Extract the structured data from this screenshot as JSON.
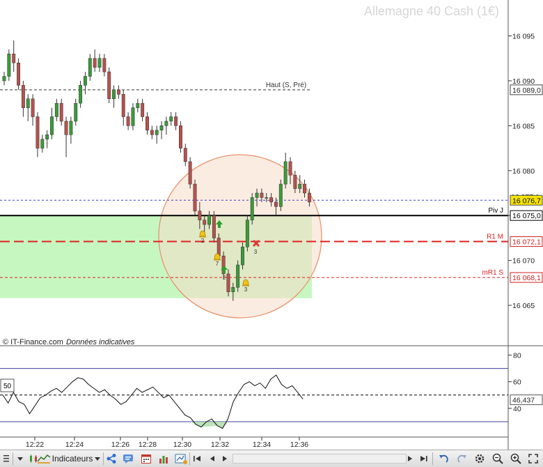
{
  "header": {
    "title": "Allemagne 40 Cash (1€)"
  },
  "footer": {
    "source": "© IT-Finance.com",
    "note": "Données indicatives"
  },
  "colors": {
    "up": "#3a9b3a",
    "down": "#b5524f",
    "zone": "#c6f7c1",
    "circle_fill": "#f8dcc8",
    "circle_stroke": "#e8936c",
    "resistance": "#e02020",
    "pivot": "#000000",
    "high": "#333333",
    "rsi_band": "#3c3c9c"
  },
  "chart_data": [
    {
      "type": "candlestick",
      "title": "Allemagne 40 Cash (1€)",
      "x_tick_labels": [
        "12:22",
        "12:24",
        "12:26",
        "12:28",
        "12:30",
        "12:32",
        "12:34",
        "12:36"
      ],
      "y_tick_labels": [
        "16 065",
        "16 070",
        "16 075",
        "16 080",
        "16 085",
        "16 090",
        "16 095"
      ],
      "ylim": [
        16060.5,
        16099
      ],
      "levels": [
        {
          "label": "Haut (S, Pré)",
          "value": 16089.0,
          "value_label": "16 089,0",
          "style": "dashed",
          "color": "#333333"
        },
        {
          "label": "",
          "value": 16076.7,
          "value_label": "16 076,7",
          "style": "dotted",
          "color": "#3c3cc8"
        },
        {
          "label": "Piv J",
          "value": 16075.0,
          "value_label": "16 075,0",
          "style": "solid",
          "color": "#000000"
        },
        {
          "label": "R1 M",
          "value": 16072.1,
          "value_label": "16 072,1",
          "style": "longdash",
          "color": "#e02020"
        },
        {
          "label": "mR1 S",
          "value": 16068.1,
          "value_label": "16 068,1",
          "style": "dashed",
          "color": "#e02020"
        }
      ],
      "partial_tick_label": "16 077,1",
      "candles": [
        [
          16090,
          16091,
          16089.5,
          16090.5
        ],
        [
          16090.5,
          16093.5,
          16090,
          16093
        ],
        [
          16093,
          16094.5,
          16091,
          16092
        ],
        [
          16092,
          16092.5,
          16089,
          16089.5
        ],
        [
          16089.5,
          16090,
          16086,
          16087
        ],
        [
          16087,
          16088.5,
          16085.5,
          16088
        ],
        [
          16088,
          16088.5,
          16085,
          16086
        ],
        [
          16086,
          16086.5,
          16081.5,
          16082.5
        ],
        [
          16082.5,
          16084,
          16082,
          16083.5
        ],
        [
          16083.5,
          16084.5,
          16082.5,
          16084
        ],
        [
          16084,
          16087,
          16083.5,
          16086
        ],
        [
          16086,
          16088,
          16085.5,
          16087.5
        ],
        [
          16087.5,
          16088,
          16085,
          16085.5
        ],
        [
          16085.5,
          16086,
          16081.5,
          16084
        ],
        [
          16084,
          16086,
          16083,
          16085.5
        ],
        [
          16085.5,
          16088,
          16085,
          16087.5
        ],
        [
          16087.5,
          16090,
          16087,
          16089.5
        ],
        [
          16089.5,
          16091,
          16088.5,
          16090.5
        ],
        [
          16090.5,
          16093,
          16090,
          16092.5
        ],
        [
          16092.5,
          16093.5,
          16091,
          16091.5
        ],
        [
          16091.5,
          16093,
          16091,
          16092.5
        ],
        [
          16092.5,
          16093,
          16090.5,
          16091
        ],
        [
          16091,
          16091.5,
          16087.5,
          16088
        ],
        [
          16088,
          16089.5,
          16087,
          16089
        ],
        [
          16089,
          16089.5,
          16088,
          16088.5
        ],
        [
          16088.5,
          16089,
          16085,
          16086
        ],
        [
          16086,
          16086.5,
          16084.5,
          16085
        ],
        [
          16085,
          16087.5,
          16084.5,
          16087
        ],
        [
          16087,
          16088,
          16086.5,
          16087.5
        ],
        [
          16087.5,
          16088,
          16085.5,
          16086
        ],
        [
          16086,
          16086.5,
          16084,
          16084.5
        ],
        [
          16084.5,
          16085,
          16083.5,
          16084
        ],
        [
          16084,
          16085,
          16083,
          16084.5
        ],
        [
          16084.5,
          16085.5,
          16083.5,
          16085
        ],
        [
          16085,
          16086,
          16084,
          16085.5
        ],
        [
          16085.5,
          16086.5,
          16085,
          16086
        ],
        [
          16086,
          16086.5,
          16084.5,
          16085
        ],
        [
          16085,
          16085.5,
          16082,
          16082.5
        ],
        [
          16082.5,
          16083,
          16080.5,
          16081
        ],
        [
          16081,
          16081.5,
          16078,
          16078.5
        ],
        [
          16078.5,
          16079,
          16075,
          16075.5
        ],
        [
          16075.5,
          16076.5,
          16073.5,
          16074.5
        ],
        [
          16074.5,
          16075,
          16073,
          16074
        ],
        [
          16074,
          16075.5,
          16073.5,
          16075
        ],
        [
          16075,
          16075.5,
          16072,
          16072.5
        ],
        [
          16072.5,
          16073,
          16070,
          16070.5
        ],
        [
          16070.5,
          16071,
          16068,
          16068.5
        ],
        [
          16068.5,
          16069,
          16066,
          16066.5
        ],
        [
          16066.5,
          16067.5,
          16065.5,
          16067
        ],
        [
          16067,
          16070,
          16066.5,
          16069.5
        ],
        [
          16069.5,
          16072,
          16069,
          16071.5
        ],
        [
          16071.5,
          16075,
          16071,
          16074.5
        ],
        [
          16074.5,
          16077.5,
          16074,
          16077
        ],
        [
          16077,
          16078,
          16076,
          16077.5
        ],
        [
          16077.5,
          16078,
          16076.5,
          16077
        ],
        [
          16077,
          16077.5,
          16076.5,
          16077
        ],
        [
          16077,
          16077.5,
          16076,
          16076.5
        ],
        [
          16076.5,
          16077,
          16075,
          16076
        ],
        [
          16076,
          16079,
          16075.5,
          16078.5
        ],
        [
          16078.5,
          16082,
          16078,
          16081
        ],
        [
          16081,
          16081.5,
          16078.5,
          16079.5
        ],
        [
          16079.5,
          16080,
          16077.5,
          16078
        ],
        [
          16078,
          16079.5,
          16077.5,
          16078.5
        ],
        [
          16078.5,
          16079,
          16077,
          16077.5
        ],
        [
          16077.5,
          16078,
          16076,
          16076.5
        ]
      ]
    },
    {
      "type": "line",
      "title": "",
      "y_tick_labels": [
        "40",
        "60",
        "80"
      ],
      "ylim": [
        19,
        86
      ],
      "bands": [
        70,
        30
      ],
      "midline": 50,
      "box_label": "50",
      "last_value_label": "46,437",
      "values": [
        50,
        44,
        52,
        45,
        43,
        36,
        42,
        48,
        50,
        53,
        55,
        52,
        56,
        60,
        63,
        62,
        58,
        55,
        52,
        54,
        50,
        47,
        43,
        45,
        50,
        55,
        52,
        54,
        56,
        52,
        48,
        50,
        45,
        40,
        35,
        33,
        28,
        26,
        30,
        32,
        27,
        25,
        32,
        45,
        52,
        58,
        60,
        57,
        59,
        55,
        62,
        65,
        58,
        55,
        57,
        52,
        47
      ]
    }
  ],
  "toolbar": {
    "indicators_label": "Indicateurs",
    "icons": [
      "chevron-down-icon",
      "candles-icon",
      "indicators-icon",
      "share-icon",
      "chat-icon",
      "calendar-icon",
      "bar-chart-icon",
      "alert-chart-icon",
      "grid-icon",
      "crosshair-icon",
      "draw-icon",
      "scroll-left-icon",
      "scroll-right-icon",
      "undo-icon",
      "redo-icon",
      "settings-icon",
      "zoom-out-icon",
      "zoom-in-icon"
    ]
  }
}
